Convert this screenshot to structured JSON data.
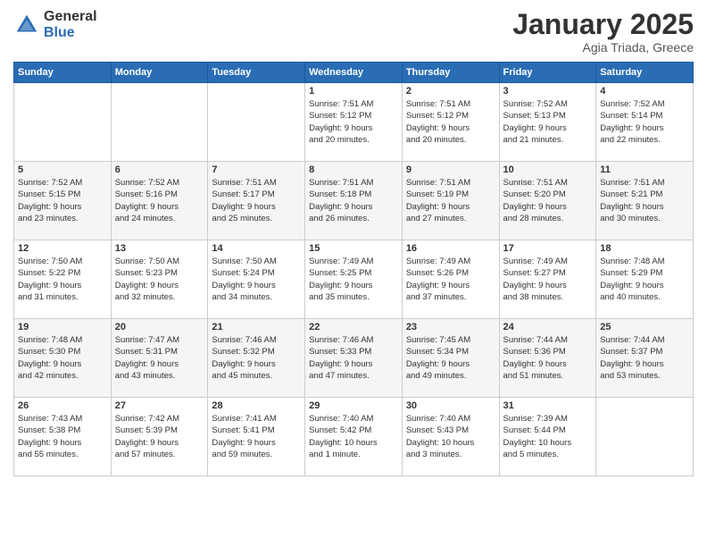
{
  "logo": {
    "general": "General",
    "blue": "Blue"
  },
  "header": {
    "month": "January 2025",
    "location": "Agia Triada, Greece"
  },
  "days_of_week": [
    "Sunday",
    "Monday",
    "Tuesday",
    "Wednesday",
    "Thursday",
    "Friday",
    "Saturday"
  ],
  "weeks": [
    [
      {
        "day": "",
        "info": ""
      },
      {
        "day": "",
        "info": ""
      },
      {
        "day": "",
        "info": ""
      },
      {
        "day": "1",
        "info": "Sunrise: 7:51 AM\nSunset: 5:12 PM\nDaylight: 9 hours\nand 20 minutes."
      },
      {
        "day": "2",
        "info": "Sunrise: 7:51 AM\nSunset: 5:12 PM\nDaylight: 9 hours\nand 20 minutes."
      },
      {
        "day": "3",
        "info": "Sunrise: 7:52 AM\nSunset: 5:13 PM\nDaylight: 9 hours\nand 21 minutes."
      },
      {
        "day": "4",
        "info": "Sunrise: 7:52 AM\nSunset: 5:14 PM\nDaylight: 9 hours\nand 22 minutes."
      }
    ],
    [
      {
        "day": "5",
        "info": "Sunrise: 7:52 AM\nSunset: 5:15 PM\nDaylight: 9 hours\nand 23 minutes."
      },
      {
        "day": "6",
        "info": "Sunrise: 7:52 AM\nSunset: 5:16 PM\nDaylight: 9 hours\nand 24 minutes."
      },
      {
        "day": "7",
        "info": "Sunrise: 7:51 AM\nSunset: 5:17 PM\nDaylight: 9 hours\nand 25 minutes."
      },
      {
        "day": "8",
        "info": "Sunrise: 7:51 AM\nSunset: 5:18 PM\nDaylight: 9 hours\nand 26 minutes."
      },
      {
        "day": "9",
        "info": "Sunrise: 7:51 AM\nSunset: 5:19 PM\nDaylight: 9 hours\nand 27 minutes."
      },
      {
        "day": "10",
        "info": "Sunrise: 7:51 AM\nSunset: 5:20 PM\nDaylight: 9 hours\nand 28 minutes."
      },
      {
        "day": "11",
        "info": "Sunrise: 7:51 AM\nSunset: 5:21 PM\nDaylight: 9 hours\nand 30 minutes."
      }
    ],
    [
      {
        "day": "12",
        "info": "Sunrise: 7:50 AM\nSunset: 5:22 PM\nDaylight: 9 hours\nand 31 minutes."
      },
      {
        "day": "13",
        "info": "Sunrise: 7:50 AM\nSunset: 5:23 PM\nDaylight: 9 hours\nand 32 minutes."
      },
      {
        "day": "14",
        "info": "Sunrise: 7:50 AM\nSunset: 5:24 PM\nDaylight: 9 hours\nand 34 minutes."
      },
      {
        "day": "15",
        "info": "Sunrise: 7:49 AM\nSunset: 5:25 PM\nDaylight: 9 hours\nand 35 minutes."
      },
      {
        "day": "16",
        "info": "Sunrise: 7:49 AM\nSunset: 5:26 PM\nDaylight: 9 hours\nand 37 minutes."
      },
      {
        "day": "17",
        "info": "Sunrise: 7:49 AM\nSunset: 5:27 PM\nDaylight: 9 hours\nand 38 minutes."
      },
      {
        "day": "18",
        "info": "Sunrise: 7:48 AM\nSunset: 5:29 PM\nDaylight: 9 hours\nand 40 minutes."
      }
    ],
    [
      {
        "day": "19",
        "info": "Sunrise: 7:48 AM\nSunset: 5:30 PM\nDaylight: 9 hours\nand 42 minutes."
      },
      {
        "day": "20",
        "info": "Sunrise: 7:47 AM\nSunset: 5:31 PM\nDaylight: 9 hours\nand 43 minutes."
      },
      {
        "day": "21",
        "info": "Sunrise: 7:46 AM\nSunset: 5:32 PM\nDaylight: 9 hours\nand 45 minutes."
      },
      {
        "day": "22",
        "info": "Sunrise: 7:46 AM\nSunset: 5:33 PM\nDaylight: 9 hours\nand 47 minutes."
      },
      {
        "day": "23",
        "info": "Sunrise: 7:45 AM\nSunset: 5:34 PM\nDaylight: 9 hours\nand 49 minutes."
      },
      {
        "day": "24",
        "info": "Sunrise: 7:44 AM\nSunset: 5:36 PM\nDaylight: 9 hours\nand 51 minutes."
      },
      {
        "day": "25",
        "info": "Sunrise: 7:44 AM\nSunset: 5:37 PM\nDaylight: 9 hours\nand 53 minutes."
      }
    ],
    [
      {
        "day": "26",
        "info": "Sunrise: 7:43 AM\nSunset: 5:38 PM\nDaylight: 9 hours\nand 55 minutes."
      },
      {
        "day": "27",
        "info": "Sunrise: 7:42 AM\nSunset: 5:39 PM\nDaylight: 9 hours\nand 57 minutes."
      },
      {
        "day": "28",
        "info": "Sunrise: 7:41 AM\nSunset: 5:41 PM\nDaylight: 9 hours\nand 59 minutes."
      },
      {
        "day": "29",
        "info": "Sunrise: 7:40 AM\nSunset: 5:42 PM\nDaylight: 10 hours\nand 1 minute."
      },
      {
        "day": "30",
        "info": "Sunrise: 7:40 AM\nSunset: 5:43 PM\nDaylight: 10 hours\nand 3 minutes."
      },
      {
        "day": "31",
        "info": "Sunrise: 7:39 AM\nSunset: 5:44 PM\nDaylight: 10 hours\nand 5 minutes."
      },
      {
        "day": "",
        "info": ""
      }
    ]
  ]
}
